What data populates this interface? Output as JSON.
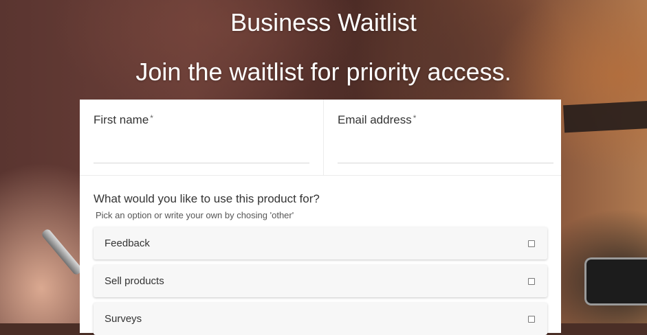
{
  "header": {
    "title": "Business Waitlist",
    "subtitle": "Join the waitlist for priority access."
  },
  "form": {
    "first_name": {
      "label": "First name",
      "required_mark": "*",
      "value": ""
    },
    "email": {
      "label": "Email address",
      "required_mark": "*",
      "value": ""
    },
    "question": {
      "label": "What would you like to use this product for?",
      "hint": "Pick an option or write your own by chosing 'other'",
      "options": [
        {
          "label": "Feedback",
          "checked": false
        },
        {
          "label": "Sell products",
          "checked": false
        },
        {
          "label": "Surveys",
          "checked": false
        }
      ]
    }
  }
}
